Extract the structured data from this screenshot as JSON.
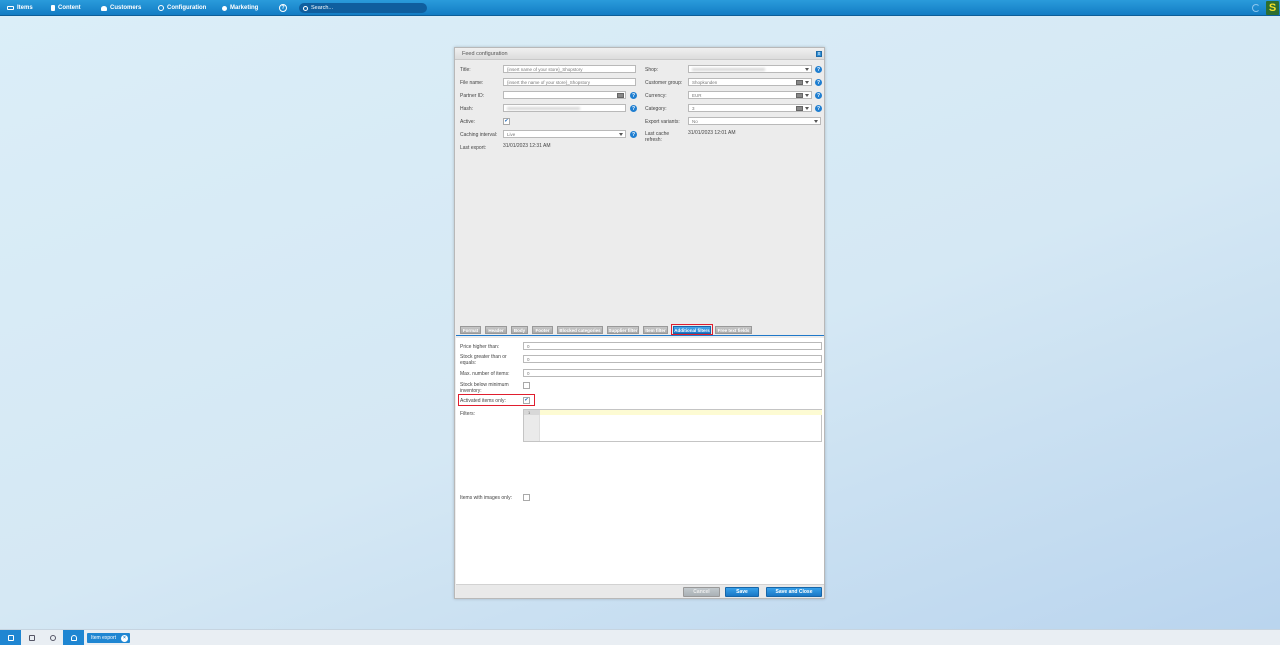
{
  "topbar": {
    "nav": [
      {
        "label": "Items",
        "icon": "items-icon"
      },
      {
        "label": "Content",
        "icon": "content-icon"
      },
      {
        "label": "Customers",
        "icon": "customers-icon"
      },
      {
        "label": "Configuration",
        "icon": "configuration-icon"
      },
      {
        "label": "Marketing",
        "icon": "marketing-icon"
      }
    ],
    "help": "?",
    "search_placeholder": "Search...",
    "logo": "S"
  },
  "window": {
    "title": "Feed configuration",
    "close": "x",
    "left_fields": {
      "title_label": "Title:",
      "title_value": "{insert name of your store}_Shopstory",
      "file_name_label": "File name:",
      "file_name_value": "{insert the name of your store}_Shopstory",
      "partner_id_label": "Partner ID:",
      "partner_id_value": "",
      "hash_label": "Hash:",
      "active_label": "Active:",
      "active_checked": "✔",
      "caching_label": "Caching interval:",
      "caching_value": "Live",
      "last_export_label": "Last export:",
      "last_export_value": "31/01/2023 12:31 AM"
    },
    "right_fields": {
      "shop_label": "Shop:",
      "customer_group_label": "Customer group:",
      "customer_group_value": "Shopkunden",
      "currency_label": "Currency:",
      "currency_value": "EUR",
      "category_label": "Category:",
      "category_value": "3",
      "export_variants_label": "Export variants:",
      "export_variants_value": "No",
      "last_cache_label": "Last cache refresh:",
      "last_cache_value": "31/01/2023 12:01 AM"
    },
    "help_glyph": "?",
    "tabs": [
      {
        "label": "Format",
        "active": false
      },
      {
        "label": "Header",
        "active": false
      },
      {
        "label": "Body",
        "active": false
      },
      {
        "label": "Footer",
        "active": false
      },
      {
        "label": "Blocked categories",
        "active": false
      },
      {
        "label": "Supplier filter",
        "active": false
      },
      {
        "label": "Item filter",
        "active": false
      },
      {
        "label": "Additional filters",
        "active": true
      },
      {
        "label": "Free text fields",
        "active": false
      }
    ],
    "filters": {
      "price_label": "Price higher than:",
      "price_value": "0",
      "stock_label": "Stock greater than or equals:",
      "stock_value": "0",
      "max_items_label": "Max. number of items:",
      "max_items_value": "0",
      "stock_below_label": "Stock below minimum inventory:",
      "activated_label": "Activated items only:",
      "activated_checked": "✔",
      "filters_label": "Filters:",
      "editor_line_number": "1",
      "images_label": "Items with images only:"
    },
    "buttons": {
      "cancel": "Cancel",
      "save": "Save",
      "save_close": "Save and Close"
    }
  },
  "taskbar": {
    "task_label": "Item export",
    "task_close": "×"
  }
}
